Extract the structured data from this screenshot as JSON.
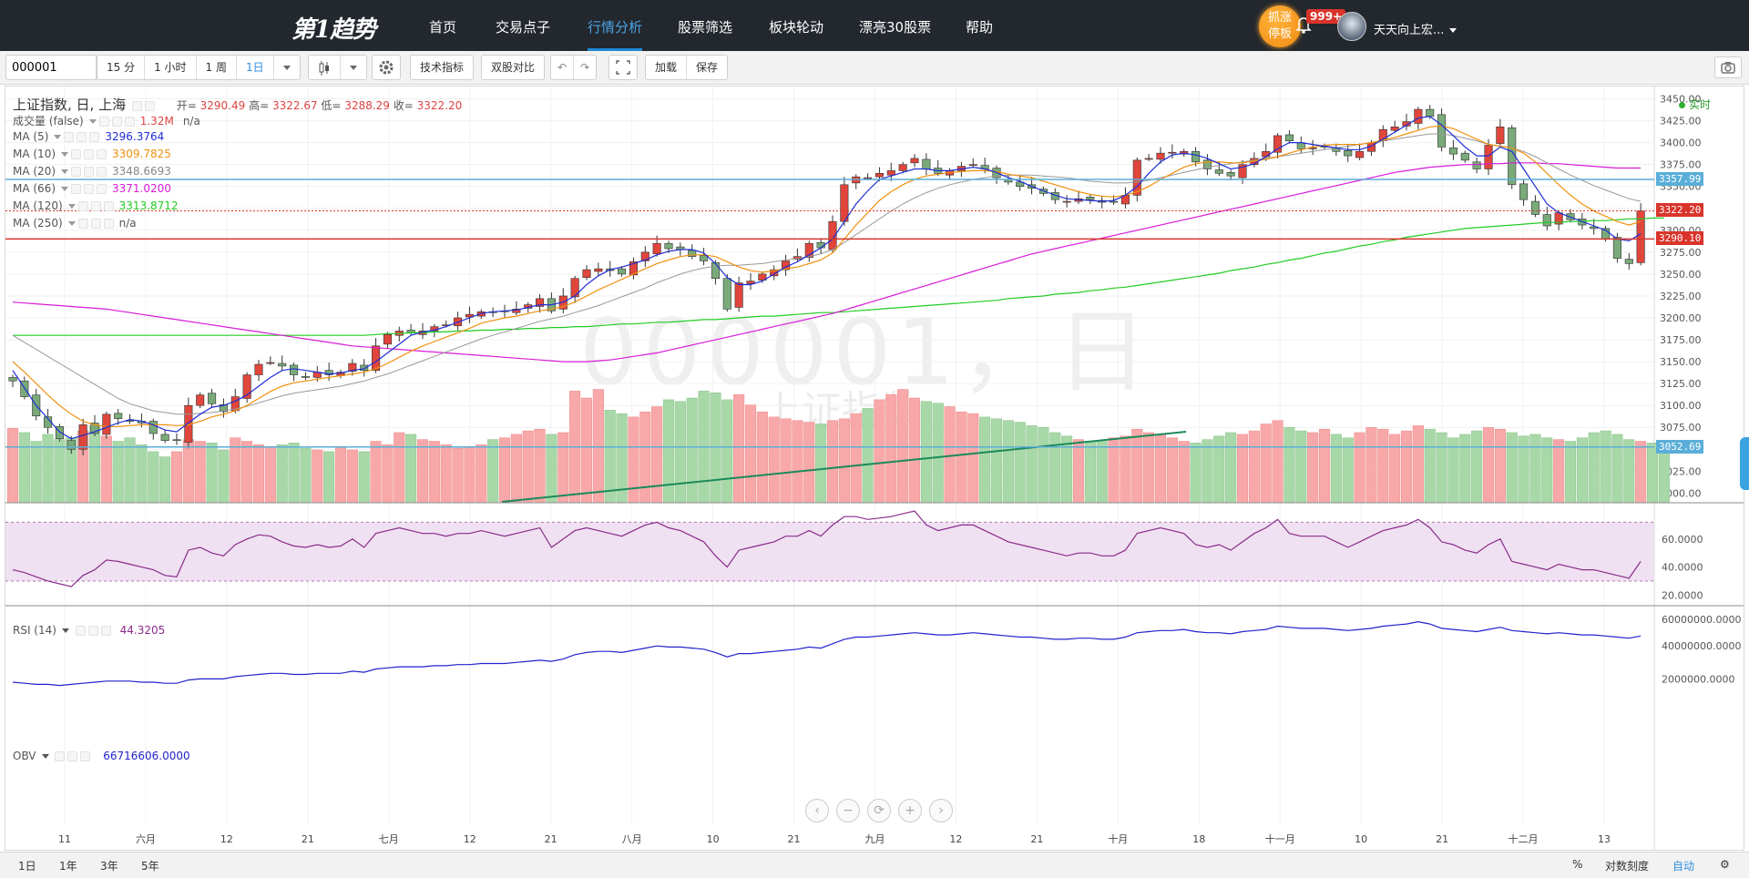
{
  "nav": {
    "logo": "第1趋势",
    "items": [
      "首页",
      "交易点子",
      "行情分析",
      "股票筛选",
      "板块轮动",
      "漂亮30股票",
      "帮助"
    ],
    "active_index": 2,
    "hot_badge": "抓涨停板",
    "notifications": "999+",
    "username": "天天向上宏..."
  },
  "toolbar": {
    "symbol": "000001",
    "intervals": [
      "15 分",
      "1 小时",
      "1 周",
      "1日"
    ],
    "selected_interval": "1日",
    "indicators_label": "技术指标",
    "compare_label": "双股对比",
    "load_label": "加载",
    "save_label": "保存"
  },
  "chart_header": {
    "title": "上证指数, 日, 上海",
    "open_label": "开=",
    "open": "3290.49",
    "high_label": "高=",
    "high": "3322.67",
    "low_label": "低=",
    "low": "3288.29",
    "close_label": "收=",
    "close": "3322.20",
    "realtime": "实时"
  },
  "legends": [
    {
      "name": "成交量 (false)",
      "value": "1.32M",
      "value2": "n/a",
      "color": "#d44"
    },
    {
      "name": "MA (5)",
      "value": "3296.3764",
      "color": "#1f2ed6"
    },
    {
      "name": "MA (10)",
      "value": "3309.7825",
      "color": "#f0900e"
    },
    {
      "name": "MA (20)",
      "value": "3348.6693",
      "color": "#888888"
    },
    {
      "name": "MA (66)",
      "value": "3371.0200",
      "color": "#d81bd8"
    },
    {
      "name": "MA (120)",
      "value": "3313.8712",
      "color": "#22cc22"
    },
    {
      "name": "MA (250)",
      "value": "n/a",
      "color": "#555555"
    }
  ],
  "rsi": {
    "name": "RSI (14)",
    "value": "44.3205",
    "color": "#8a2b8a",
    "levels": [
      70,
      30
    ]
  },
  "obv": {
    "name": "OBV",
    "value": "66716606.0000",
    "color": "#2222cc"
  },
  "watermark": {
    "symbol": "000001，日",
    "name": "上证指数"
  },
  "price_tags": [
    {
      "label": "3357.99",
      "price": 3357.99,
      "color": "#5aaed9"
    },
    {
      "label": "3322.20",
      "price": 3322.2,
      "color": "#d9342b"
    },
    {
      "label": "3290.10",
      "price": 3290.1,
      "color": "#d9342b"
    },
    {
      "label": "3052.69",
      "price": 3052.69,
      "color": "#5aaed9"
    }
  ],
  "chart_data": {
    "type": "candlestick",
    "price_axis": {
      "ticks": [
        3000,
        3025,
        3050,
        3075,
        3100,
        3125,
        3150,
        3175,
        3200,
        3225,
        3250,
        3275,
        3300,
        3325,
        3350,
        3375,
        3400,
        3425,
        3450
      ],
      "ylim": [
        2990,
        3462
      ]
    },
    "rsi_axis": {
      "ticks": [
        "20.0000",
        "40.0000",
        "60.0000"
      ]
    },
    "obv_axis": {
      "ticks": [
        "2000000.0000",
        "40000000.0000",
        "60000000.0000"
      ]
    },
    "x_labels": [
      "11",
      "六月",
      "12",
      "21",
      "七月",
      "12",
      "21",
      "八月",
      "10",
      "21",
      "九月",
      "12",
      "21",
      "十月",
      "18",
      "十一月",
      "10",
      "21",
      "十二月",
      "13"
    ],
    "close": [
      3128,
      3110,
      3088,
      3075,
      3062,
      3050,
      3078,
      3068,
      3090,
      3085,
      3082,
      3080,
      3068,
      3060,
      3060,
      3100,
      3112,
      3102,
      3093,
      3110,
      3135,
      3147,
      3149,
      3145,
      3135,
      3132,
      3138,
      3135,
      3138,
      3148,
      3140,
      3168,
      3181,
      3185,
      3183,
      3185,
      3190,
      3192,
      3200,
      3204,
      3207,
      3206,
      3207,
      3210,
      3215,
      3222,
      3208,
      3225,
      3245,
      3255,
      3256,
      3254,
      3250,
      3264,
      3275,
      3285,
      3279,
      3278,
      3270,
      3265,
      3245,
      3210,
      3240,
      3242,
      3250,
      3255,
      3265,
      3270,
      3285,
      3280,
      3310,
      3352,
      3361,
      3360,
      3365,
      3368,
      3375,
      3382,
      3370,
      3365,
      3368,
      3373,
      3375,
      3370,
      3360,
      3355,
      3350,
      3348,
      3342,
      3335,
      3333,
      3336,
      3335,
      3332,
      3332,
      3340,
      3380,
      3382,
      3388,
      3389,
      3390,
      3378,
      3370,
      3365,
      3362,
      3375,
      3382,
      3390,
      3408,
      3402,
      3393,
      3394,
      3395,
      3390,
      3385,
      3390,
      3400,
      3415,
      3418,
      3424,
      3438,
      3430,
      3395,
      3387,
      3380,
      3370,
      3397,
      3418,
      3352,
      3335,
      3318,
      3305,
      3320,
      3312,
      3306,
      3302,
      3290,
      3268,
      3262,
      3322
    ],
    "ma5": [
      3140,
      3120,
      3100,
      3085,
      3070,
      3062,
      3066,
      3070,
      3075,
      3080,
      3084,
      3082,
      3078,
      3072,
      3070,
      3080,
      3090,
      3098,
      3100,
      3105,
      3112,
      3122,
      3132,
      3140,
      3142,
      3140,
      3138,
      3136,
      3137,
      3140,
      3142,
      3150,
      3160,
      3170,
      3180,
      3184,
      3186,
      3190,
      3195,
      3200,
      3205,
      3207,
      3208,
      3209,
      3212,
      3215,
      3215,
      3218,
      3225,
      3238,
      3248,
      3255,
      3258,
      3262,
      3266,
      3272,
      3276,
      3278,
      3278,
      3274,
      3262,
      3246,
      3238,
      3238,
      3242,
      3250,
      3258,
      3264,
      3272,
      3280,
      3290,
      3310,
      3330,
      3345,
      3358,
      3362,
      3366,
      3370,
      3370,
      3368,
      3368,
      3370,
      3372,
      3370,
      3366,
      3360,
      3356,
      3350,
      3345,
      3340,
      3336,
      3335,
      3334,
      3333,
      3334,
      3340,
      3350,
      3365,
      3378,
      3386,
      3388,
      3386,
      3382,
      3376,
      3370,
      3372,
      3376,
      3384,
      3393,
      3400,
      3400,
      3398,
      3396,
      3394,
      3392,
      3392,
      3396,
      3404,
      3412,
      3420,
      3428,
      3430,
      3420,
      3408,
      3395,
      3385,
      3385,
      3395,
      3390,
      3370,
      3350,
      3330,
      3320,
      3315,
      3310,
      3305,
      3300,
      3290,
      3288,
      3296
    ],
    "ma10": [
      3150,
      3138,
      3125,
      3112,
      3100,
      3090,
      3082,
      3078,
      3076,
      3076,
      3077,
      3078,
      3078,
      3078,
      3077,
      3078,
      3082,
      3087,
      3090,
      3094,
      3100,
      3108,
      3116,
      3122,
      3126,
      3128,
      3130,
      3132,
      3134,
      3136,
      3138,
      3142,
      3148,
      3155,
      3162,
      3168,
      3173,
      3178,
      3183,
      3188,
      3194,
      3197,
      3200,
      3202,
      3205,
      3208,
      3210,
      3213,
      3218,
      3225,
      3232,
      3238,
      3244,
      3250,
      3256,
      3262,
      3266,
      3270,
      3272,
      3272,
      3270,
      3264,
      3258,
      3254,
      3252,
      3254,
      3256,
      3258,
      3262,
      3266,
      3274,
      3290,
      3306,
      3320,
      3334,
      3344,
      3352,
      3358,
      3362,
      3364,
      3366,
      3367,
      3368,
      3368,
      3367,
      3364,
      3362,
      3360,
      3356,
      3352,
      3348,
      3344,
      3341,
      3339,
      3338,
      3340,
      3344,
      3350,
      3358,
      3365,
      3372,
      3376,
      3378,
      3378,
      3377,
      3377,
      3379,
      3381,
      3384,
      3388,
      3392,
      3395,
      3397,
      3398,
      3398,
      3398,
      3400,
      3403,
      3406,
      3410,
      3414,
      3418,
      3419,
      3416,
      3410,
      3404,
      3398,
      3396,
      3394,
      3388,
      3378,
      3365,
      3352,
      3340,
      3330,
      3322,
      3316,
      3310,
      3306,
      3310
    ],
    "ma20": [
      3180,
      3172,
      3164,
      3156,
      3148,
      3140,
      3132,
      3124,
      3116,
      3108,
      3102,
      3098,
      3094,
      3092,
      3090,
      3090,
      3091,
      3092,
      3094,
      3096,
      3099,
      3103,
      3107,
      3111,
      3114,
      3116,
      3118,
      3120,
      3122,
      3125,
      3128,
      3132,
      3136,
      3141,
      3146,
      3151,
      3156,
      3161,
      3166,
      3171,
      3176,
      3180,
      3184,
      3188,
      3192,
      3196,
      3199,
      3202,
      3206,
      3210,
      3214,
      3219,
      3224,
      3229,
      3234,
      3240,
      3245,
      3250,
      3254,
      3257,
      3259,
      3260,
      3260,
      3261,
      3262,
      3264,
      3266,
      3268,
      3270,
      3273,
      3278,
      3286,
      3295,
      3304,
      3313,
      3322,
      3330,
      3337,
      3343,
      3348,
      3352,
      3355,
      3358,
      3360,
      3362,
      3363,
      3363,
      3363,
      3362,
      3361,
      3360,
      3358,
      3356,
      3355,
      3354,
      3354,
      3355,
      3357,
      3360,
      3363,
      3366,
      3369,
      3372,
      3374,
      3376,
      3378,
      3380,
      3382,
      3384,
      3386,
      3388,
      3390,
      3392,
      3394,
      3396,
      3398,
      3400,
      3402,
      3404,
      3406,
      3408,
      3410,
      3410,
      3408,
      3405,
      3402,
      3398,
      3396,
      3394,
      3390,
      3384,
      3377,
      3370,
      3363,
      3357,
      3351,
      3346,
      3341,
      3336,
      3333
    ],
    "ma66": [
      3218,
      3217,
      3216,
      3215,
      3214,
      3213,
      3212,
      3211,
      3210,
      3208,
      3206,
      3204,
      3202,
      3200,
      3198,
      3196,
      3194,
      3192,
      3190,
      3188,
      3186,
      3184,
      3182,
      3180,
      3178,
      3176,
      3174,
      3172,
      3170,
      3168,
      3167,
      3166,
      3165,
      3164,
      3163,
      3162,
      3161,
      3160,
      3159,
      3158,
      3157,
      3156,
      3155,
      3154,
      3153,
      3152,
      3151,
      3150,
      3150,
      3150,
      3151,
      3152,
      3154,
      3156,
      3158,
      3160,
      3163,
      3166,
      3169,
      3172,
      3175,
      3178,
      3181,
      3184,
      3187,
      3190,
      3193,
      3196,
      3199,
      3202,
      3205,
      3209,
      3213,
      3217,
      3221,
      3225,
      3229,
      3233,
      3237,
      3241,
      3245,
      3249,
      3253,
      3257,
      3261,
      3265,
      3269,
      3273,
      3276,
      3279,
      3282,
      3285,
      3288,
      3291,
      3294,
      3297,
      3300,
      3303,
      3306,
      3309,
      3312,
      3315,
      3318,
      3321,
      3324,
      3327,
      3330,
      3333,
      3336,
      3339,
      3342,
      3345,
      3348,
      3351,
      3354,
      3357,
      3360,
      3363,
      3366,
      3368,
      3370,
      3372,
      3373,
      3374,
      3375,
      3375,
      3376,
      3376,
      3377,
      3377,
      3377,
      3376,
      3376,
      3375,
      3374,
      3373,
      3372,
      3371,
      3371,
      3371
    ],
    "ma120": [
      3180,
      3180,
      3180,
      3180,
      3180,
      3180,
      3180,
      3180,
      3180,
      3180,
      3180,
      3180,
      3180,
      3180,
      3180,
      3180,
      3180,
      3180,
      3180,
      3180,
      3180,
      3180,
      3180,
      3180,
      3180,
      3180,
      3180,
      3180,
      3180,
      3180,
      3180,
      3181,
      3182,
      3182,
      3183,
      3183,
      3184,
      3184,
      3185,
      3185,
      3186,
      3186,
      3187,
      3187,
      3188,
      3188,
      3189,
      3189,
      3190,
      3190,
      3191,
      3192,
      3193,
      3193,
      3194,
      3195,
      3195,
      3196,
      3197,
      3198,
      3198,
      3199,
      3200,
      3201,
      3202,
      3202,
      3203,
      3204,
      3205,
      3206,
      3206,
      3207,
      3208,
      3209,
      3210,
      3211,
      3212,
      3213,
      3214,
      3215,
      3216,
      3217,
      3218,
      3219,
      3220,
      3222,
      3223,
      3224,
      3225,
      3227,
      3228,
      3229,
      3231,
      3232,
      3234,
      3235,
      3237,
      3239,
      3241,
      3243,
      3245,
      3247,
      3249,
      3251,
      3254,
      3256,
      3258,
      3261,
      3263,
      3266,
      3268,
      3271,
      3274,
      3276,
      3279,
      3282,
      3284,
      3287,
      3289,
      3292,
      3294,
      3296,
      3298,
      3300,
      3302,
      3303,
      3304,
      3305,
      3306,
      3307,
      3308,
      3309,
      3309,
      3310,
      3310,
      3311,
      3311,
      3312,
      3313,
      3313,
      3314,
      3314
    ],
    "volume": [
      85,
      80,
      70,
      78,
      72,
      74,
      82,
      88,
      76,
      70,
      74,
      66,
      58,
      52,
      58,
      72,
      70,
      68,
      60,
      74,
      70,
      66,
      64,
      66,
      68,
      62,
      60,
      58,
      64,
      60,
      58,
      70,
      66,
      80,
      78,
      72,
      70,
      66,
      62,
      64,
      66,
      72,
      74,
      78,
      82,
      84,
      78,
      80,
      128,
      120,
      130,
      106,
      102,
      98,
      104,
      110,
      118,
      116,
      120,
      128,
      126,
      118,
      124,
      112,
      104,
      98,
      96,
      94,
      92,
      90,
      94,
      96,
      102,
      108,
      118,
      124,
      130,
      120,
      116,
      114,
      110,
      104,
      102,
      98,
      96,
      94,
      92,
      88,
      86,
      80,
      76,
      72,
      70,
      70,
      74,
      76,
      84,
      80,
      78,
      74,
      70,
      68,
      72,
      76,
      80,
      78,
      82,
      90,
      94,
      86,
      82,
      80,
      84,
      78,
      74,
      80,
      86,
      84,
      78,
      82,
      88,
      84,
      80,
      74,
      78,
      82,
      86,
      84,
      80,
      76,
      78,
      74,
      72,
      70,
      74,
      80,
      82,
      78,
      72,
      70,
      68,
      66
    ],
    "rsi": [
      38,
      36,
      33,
      30,
      28,
      26,
      34,
      38,
      45,
      44,
      42,
      40,
      38,
      34,
      33,
      52,
      54,
      50,
      48,
      56,
      60,
      63,
      62,
      58,
      55,
      54,
      56,
      54,
      55,
      60,
      54,
      64,
      66,
      68,
      66,
      64,
      64,
      62,
      64,
      64,
      66,
      64,
      62,
      64,
      66,
      68,
      54,
      60,
      66,
      68,
      66,
      64,
      62,
      66,
      70,
      72,
      68,
      66,
      62,
      58,
      48,
      40,
      52,
      54,
      56,
      58,
      62,
      62,
      66,
      62,
      70,
      76,
      76,
      74,
      75,
      76,
      78,
      80,
      70,
      66,
      68,
      70,
      70,
      66,
      62,
      58,
      56,
      54,
      52,
      50,
      48,
      50,
      50,
      48,
      48,
      52,
      64,
      66,
      68,
      66,
      64,
      56,
      54,
      56,
      52,
      58,
      64,
      68,
      74,
      64,
      62,
      62,
      62,
      58,
      54,
      58,
      62,
      66,
      68,
      70,
      74,
      68,
      58,
      56,
      52,
      50,
      56,
      60,
      44,
      42,
      40,
      38,
      42,
      40,
      38,
      38,
      36,
      34,
      32,
      44
    ],
    "obv": [
      5,
      4,
      3,
      3,
      2,
      3,
      4,
      5,
      6,
      6,
      6,
      5,
      5,
      4,
      4,
      7,
      8,
      8,
      8,
      10,
      11,
      12,
      13,
      13,
      12,
      12,
      13,
      13,
      13,
      15,
      14,
      17,
      18,
      19,
      19,
      19,
      20,
      20,
      21,
      21,
      22,
      22,
      22,
      23,
      24,
      25,
      24,
      26,
      30,
      32,
      33,
      33,
      32,
      34,
      36,
      38,
      37,
      37,
      36,
      35,
      32,
      28,
      31,
      31,
      32,
      33,
      34,
      35,
      37,
      36,
      40,
      44,
      46,
      46,
      47,
      48,
      49,
      50,
      49,
      48,
      48,
      49,
      50,
      49,
      48,
      47,
      46,
      46,
      45,
      44,
      44,
      45,
      45,
      44,
      44,
      46,
      50,
      51,
      52,
      52,
      53,
      51,
      50,
      50,
      49,
      51,
      52,
      53,
      56,
      55,
      54,
      54,
      54,
      53,
      52,
      53,
      54,
      56,
      57,
      58,
      60,
      58,
      54,
      53,
      52,
      51,
      53,
      55,
      52,
      51,
      50,
      49,
      50,
      49,
      48,
      48,
      47,
      46,
      45,
      47
    ]
  },
  "bottombar": {
    "ranges": [
      "1日",
      "1年",
      "3年",
      "5年"
    ],
    "pct": "%",
    "log_scale": "对数刻度",
    "auto": "自动"
  }
}
